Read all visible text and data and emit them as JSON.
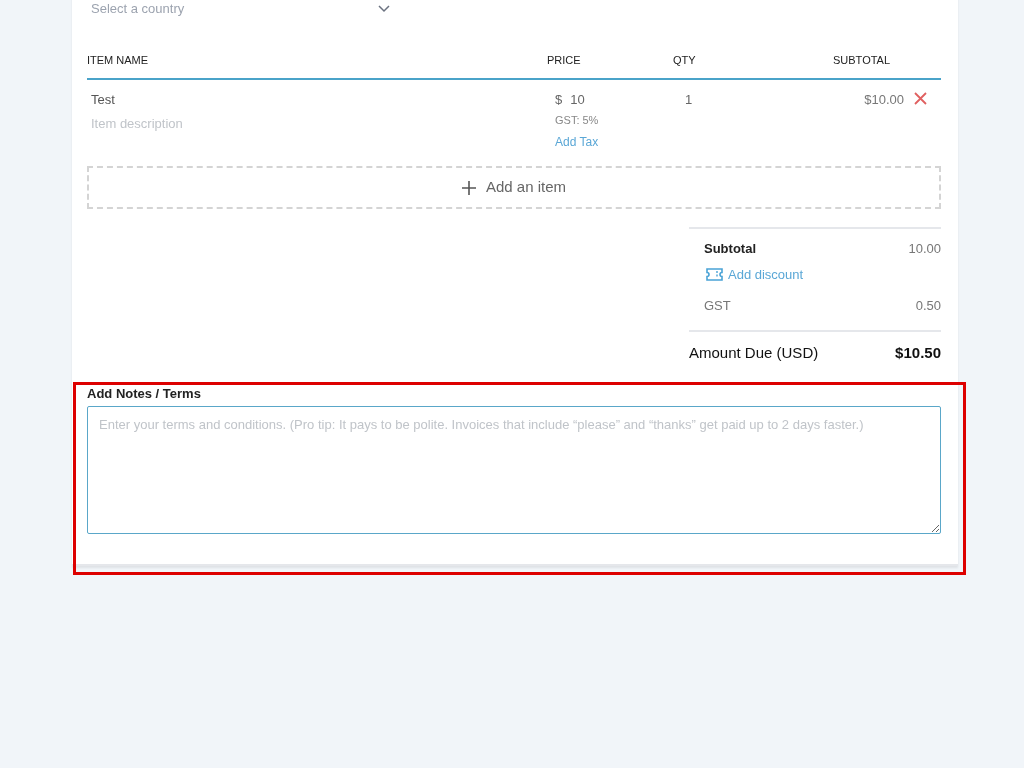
{
  "country_select": {
    "placeholder": "Select a country"
  },
  "table": {
    "columns": [
      "ITEM NAME",
      "PRICE",
      "QTY",
      "SUBTOTAL"
    ],
    "rows": [
      {
        "name": "Test",
        "description_placeholder": "Item description",
        "currency": "$",
        "price": "10",
        "tax": "GST: 5%",
        "add_tax": "Add Tax",
        "qty": "1",
        "subtotal": "$10.00"
      }
    ]
  },
  "add_item": "Add an item",
  "totals": {
    "subtotal_label": "Subtotal",
    "subtotal": "10.00",
    "add_discount": "Add discount",
    "tax_label": "GST",
    "tax": "0.50",
    "amount_due_label": "Amount Due (USD)",
    "amount_due": "$10.50"
  },
  "notes": {
    "label": "Add Notes / Terms",
    "placeholder": "Enter your terms and conditions. (Pro tip: It pays to be polite. Invoices that include “please” and “thanks” get paid up to 2 days faster.)",
    "highlighted": true
  }
}
